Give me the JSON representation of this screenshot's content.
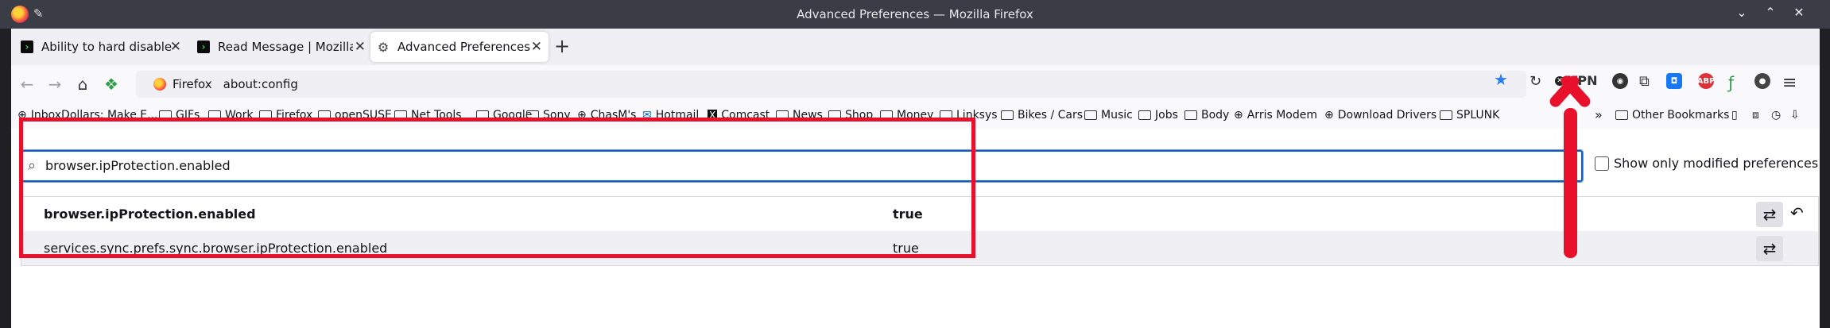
{
  "window": {
    "title": "Advanced Preferences — Mozilla Firefox"
  },
  "tabs": [
    {
      "label": "Ability to hard disable the",
      "icon": "green-terminal-icon",
      "active": false
    },
    {
      "label": "Read Message | Mozilla Su",
      "icon": "green-terminal-icon",
      "active": false
    },
    {
      "label": "Advanced Preferences",
      "icon": "gear-icon",
      "active": true
    }
  ],
  "navbar": {
    "identity_label": "Firefox",
    "url": "about:config",
    "vpn_label": "VPN"
  },
  "bookmarks": [
    {
      "label": "InboxDollars: Make E...",
      "icon": "globe"
    },
    {
      "label": "GIFs",
      "icon": "folder"
    },
    {
      "label": "Work",
      "icon": "folder"
    },
    {
      "label": "Firefox",
      "icon": "folder"
    },
    {
      "label": "openSUSE",
      "icon": "folder"
    },
    {
      "label": "Net Tools",
      "icon": "folder"
    },
    {
      "label": "Google",
      "icon": "folder"
    },
    {
      "label": "Sony",
      "icon": "folder"
    },
    {
      "label": "ChasM's",
      "icon": "globe"
    },
    {
      "label": "Hotmail",
      "icon": "outlook"
    },
    {
      "label": "Comcast",
      "icon": "x"
    },
    {
      "label": "News",
      "icon": "folder"
    },
    {
      "label": "Shop",
      "icon": "folder"
    },
    {
      "label": "Money",
      "icon": "folder"
    },
    {
      "label": "Linksys",
      "icon": "folder"
    },
    {
      "label": "Bikes / Cars",
      "icon": "folder"
    },
    {
      "label": "Music",
      "icon": "folder"
    },
    {
      "label": "Jobs",
      "icon": "folder"
    },
    {
      "label": "Body",
      "icon": "folder"
    },
    {
      "label": "Arris Modem",
      "icon": "globe"
    },
    {
      "label": "Download Drivers",
      "icon": "globe"
    },
    {
      "label": "SPLUNK",
      "icon": "folder"
    }
  ],
  "bookmarks_overflow": "»",
  "other_bookmarks": "Other Bookmarks",
  "config": {
    "search_value": "browser.ipProtection.enabled",
    "show_modified_label": "Show only modified preferences",
    "rows": [
      {
        "name": "browser.ipProtection.enabled",
        "value": "true",
        "modified": true
      },
      {
        "name": "services.sync.prefs.sync.browser.ipProtection.enabled",
        "value": "true",
        "modified": false
      }
    ]
  },
  "colors": {
    "annotation": "#e8102b",
    "focus": "#0061e0",
    "star": "#2c7ef3"
  }
}
